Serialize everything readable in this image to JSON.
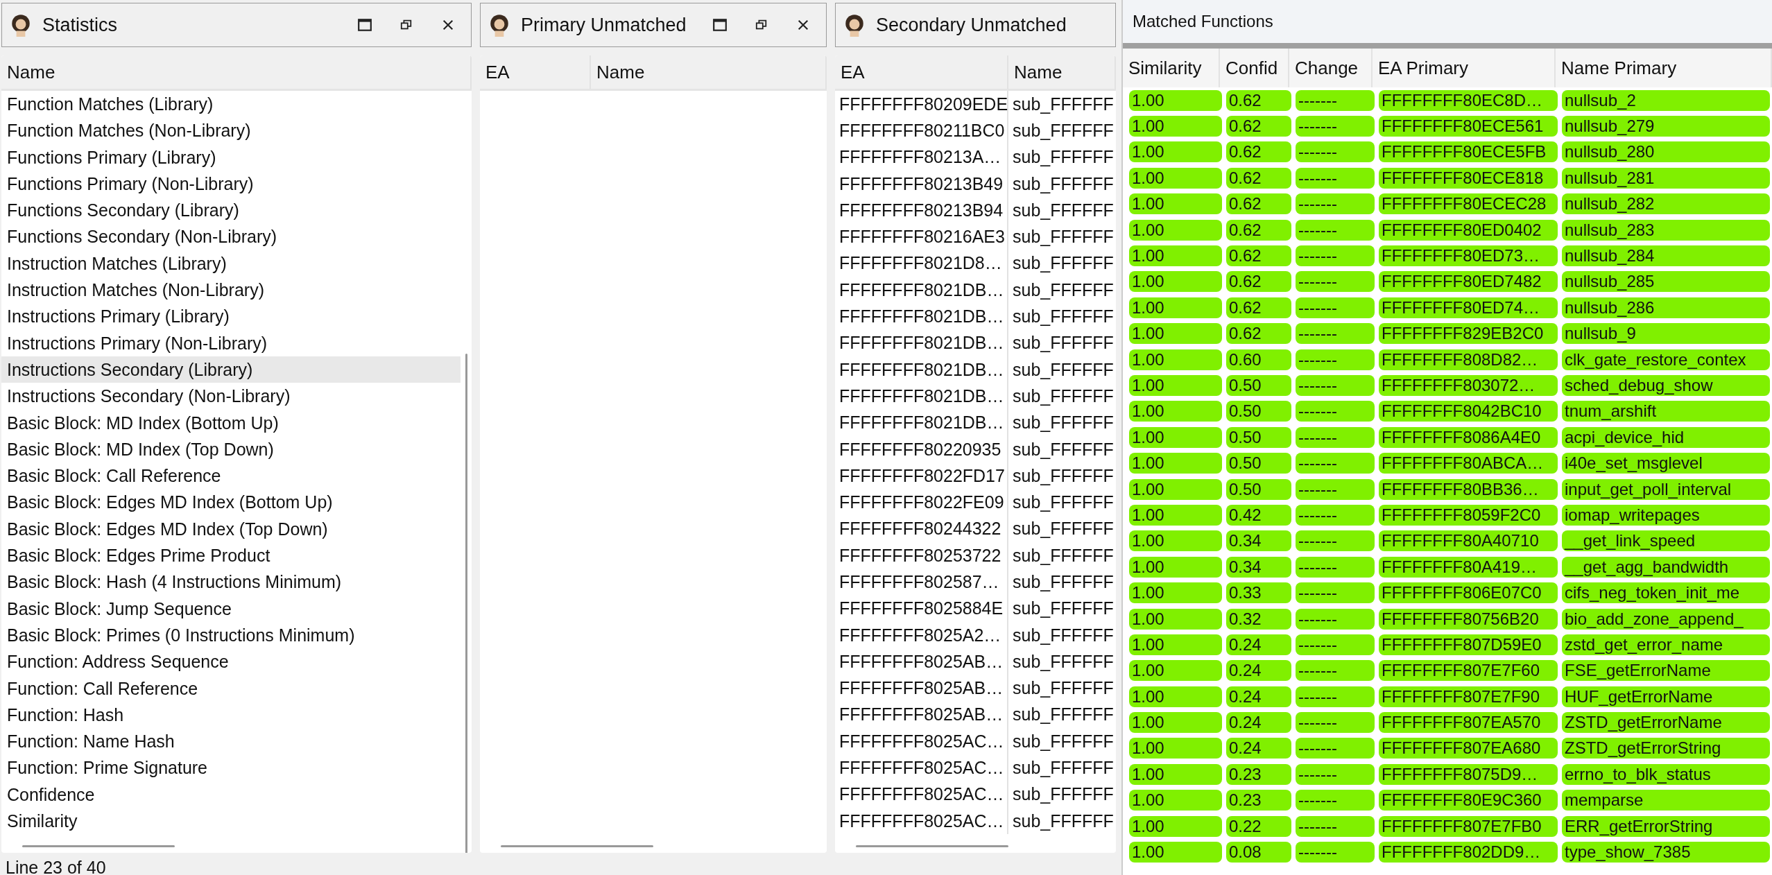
{
  "statistics": {
    "title": "Statistics",
    "column": "Name",
    "items": [
      {
        "label": "Function Matches (Library)",
        "selected": false
      },
      {
        "label": "Function Matches (Non-Library)",
        "selected": false
      },
      {
        "label": "Functions Primary (Library)",
        "selected": false
      },
      {
        "label": "Functions Primary (Non-Library)",
        "selected": false
      },
      {
        "label": "Functions Secondary (Library)",
        "selected": false
      },
      {
        "label": "Functions Secondary (Non-Library)",
        "selected": false
      },
      {
        "label": "Instruction Matches (Library)",
        "selected": false
      },
      {
        "label": "Instruction Matches (Non-Library)",
        "selected": false
      },
      {
        "label": "Instructions Primary (Library)",
        "selected": false
      },
      {
        "label": "Instructions Primary (Non-Library)",
        "selected": false
      },
      {
        "label": "Instructions Secondary (Library)",
        "selected": true
      },
      {
        "label": "Instructions Secondary (Non-Library)",
        "selected": false
      },
      {
        "label": "Basic Block: MD Index (Bottom Up)",
        "selected": false
      },
      {
        "label": "Basic Block: MD Index (Top Down)",
        "selected": false
      },
      {
        "label": "Basic Block: Call Reference",
        "selected": false
      },
      {
        "label": "Basic Block: Edges MD Index (Bottom Up)",
        "selected": false
      },
      {
        "label": "Basic Block: Edges MD Index (Top Down)",
        "selected": false
      },
      {
        "label": "Basic Block: Edges Prime Product",
        "selected": false
      },
      {
        "label": "Basic Block: Hash (4 Instructions Minimum)",
        "selected": false
      },
      {
        "label": "Basic Block: Jump Sequence",
        "selected": false
      },
      {
        "label": "Basic Block: Primes (0 Instructions Minimum)",
        "selected": false
      },
      {
        "label": "Function: Address Sequence",
        "selected": false
      },
      {
        "label": "Function: Call Reference",
        "selected": false
      },
      {
        "label": "Function: Hash",
        "selected": false
      },
      {
        "label": "Function: Name Hash",
        "selected": false
      },
      {
        "label": "Function: Prime Signature",
        "selected": false
      },
      {
        "label": "Confidence",
        "selected": false
      },
      {
        "label": "Similarity",
        "selected": false
      }
    ]
  },
  "primary_unmatched": {
    "title": "Primary Unmatched",
    "columns": [
      "EA",
      "Name"
    ]
  },
  "secondary_unmatched": {
    "title": "Secondary Unmatched",
    "columns": [
      "EA",
      "Name"
    ],
    "rows": [
      [
        "FFFFFFFF80209EDE",
        "sub_FFFFFF"
      ],
      [
        "FFFFFFFF80211BC0",
        "sub_FFFFFF"
      ],
      [
        "FFFFFFFF80213A…",
        "sub_FFFFFF"
      ],
      [
        "FFFFFFFF80213B49",
        "sub_FFFFFF"
      ],
      [
        "FFFFFFFF80213B94",
        "sub_FFFFFF"
      ],
      [
        "FFFFFFFF80216AE3",
        "sub_FFFFFF"
      ],
      [
        "FFFFFFFF8021D8…",
        "sub_FFFFFF"
      ],
      [
        "FFFFFFFF8021DB…",
        "sub_FFFFFF"
      ],
      [
        "FFFFFFFF8021DB…",
        "sub_FFFFFF"
      ],
      [
        "FFFFFFFF8021DB…",
        "sub_FFFFFF"
      ],
      [
        "FFFFFFFF8021DB…",
        "sub_FFFFFF"
      ],
      [
        "FFFFFFFF8021DB…",
        "sub_FFFFFF"
      ],
      [
        "FFFFFFFF8021DB…",
        "sub_FFFFFF"
      ],
      [
        "FFFFFFFF80220935",
        "sub_FFFFFF"
      ],
      [
        "FFFFFFFF8022FD17",
        "sub_FFFFFF"
      ],
      [
        "FFFFFFFF8022FE09",
        "sub_FFFFFF"
      ],
      [
        "FFFFFFFF80244322",
        "sub_FFFFFF"
      ],
      [
        "FFFFFFFF80253722",
        "sub_FFFFFF"
      ],
      [
        "FFFFFFFF802587…",
        "sub_FFFFFF"
      ],
      [
        "FFFFFFFF8025884E",
        "sub_FFFFFF"
      ],
      [
        "FFFFFFFF8025A2…",
        "sub_FFFFFF"
      ],
      [
        "FFFFFFFF8025AB…",
        "sub_FFFFFF"
      ],
      [
        "FFFFFFFF8025AB…",
        "sub_FFFFFF"
      ],
      [
        "FFFFFFFF8025AB…",
        "sub_FFFFFF"
      ],
      [
        "FFFFFFFF8025AC…",
        "sub_FFFFFF"
      ],
      [
        "FFFFFFFF8025AC…",
        "sub_FFFFFF"
      ],
      [
        "FFFFFFFF8025AC…",
        "sub_FFFFFF"
      ],
      [
        "FFFFFFFF8025AC…",
        "sub_FFFFFF"
      ]
    ]
  },
  "matched_functions": {
    "title": "Matched Functions",
    "columns": [
      "Similarity",
      "Confid",
      "Change",
      "EA Primary",
      "Name Primary"
    ],
    "rows": [
      [
        "1.00",
        "0.62",
        "-------",
        "FFFFFFFF80EC8D…",
        "nullsub_2"
      ],
      [
        "1.00",
        "0.62",
        "-------",
        "FFFFFFFF80ECE561",
        "nullsub_279"
      ],
      [
        "1.00",
        "0.62",
        "-------",
        "FFFFFFFF80ECE5FB",
        "nullsub_280"
      ],
      [
        "1.00",
        "0.62",
        "-------",
        "FFFFFFFF80ECE818",
        "nullsub_281"
      ],
      [
        "1.00",
        "0.62",
        "-------",
        "FFFFFFFF80ECEC28",
        "nullsub_282"
      ],
      [
        "1.00",
        "0.62",
        "-------",
        "FFFFFFFF80ED0402",
        "nullsub_283"
      ],
      [
        "1.00",
        "0.62",
        "-------",
        "FFFFFFFF80ED73…",
        "nullsub_284"
      ],
      [
        "1.00",
        "0.62",
        "-------",
        "FFFFFFFF80ED7482",
        "nullsub_285"
      ],
      [
        "1.00",
        "0.62",
        "-------",
        "FFFFFFFF80ED74…",
        "nullsub_286"
      ],
      [
        "1.00",
        "0.62",
        "-------",
        "FFFFFFFF829EB2C0",
        "nullsub_9"
      ],
      [
        "1.00",
        "0.60",
        "-------",
        "FFFFFFFF808D82…",
        "clk_gate_restore_contex"
      ],
      [
        "1.00",
        "0.50",
        "-------",
        "FFFFFFFF803072…",
        "sched_debug_show"
      ],
      [
        "1.00",
        "0.50",
        "-------",
        "FFFFFFFF8042BC10",
        "tnum_arshift"
      ],
      [
        "1.00",
        "0.50",
        "-------",
        "FFFFFFFF8086A4E0",
        "acpi_device_hid"
      ],
      [
        "1.00",
        "0.50",
        "-------",
        "FFFFFFFF80ABCA…",
        "i40e_set_msglevel"
      ],
      [
        "1.00",
        "0.50",
        "-------",
        "FFFFFFFF80BB36…",
        "input_get_poll_interval"
      ],
      [
        "1.00",
        "0.42",
        "-------",
        "FFFFFFFF8059F2C0",
        "iomap_writepages"
      ],
      [
        "1.00",
        "0.34",
        "-------",
        "FFFFFFFF80A40710",
        "__get_link_speed"
      ],
      [
        "1.00",
        "0.34",
        "-------",
        "FFFFFFFF80A419…",
        "__get_agg_bandwidth"
      ],
      [
        "1.00",
        "0.33",
        "-------",
        "FFFFFFFF806E07C0",
        "cifs_neg_token_init_me"
      ],
      [
        "1.00",
        "0.32",
        "-------",
        "FFFFFFFF80756B20",
        "bio_add_zone_append_"
      ],
      [
        "1.00",
        "0.24",
        "-------",
        "FFFFFFFF807D59E0",
        "zstd_get_error_name"
      ],
      [
        "1.00",
        "0.24",
        "-------",
        "FFFFFFFF807E7F60",
        "FSE_getErrorName"
      ],
      [
        "1.00",
        "0.24",
        "-------",
        "FFFFFFFF807E7F90",
        "HUF_getErrorName"
      ],
      [
        "1.00",
        "0.24",
        "-------",
        "FFFFFFFF807EA570",
        "ZSTD_getErrorName"
      ],
      [
        "1.00",
        "0.24",
        "-------",
        "FFFFFFFF807EA680",
        "ZSTD_getErrorString"
      ],
      [
        "1.00",
        "0.23",
        "-------",
        "FFFFFFFF8075D9…",
        "errno_to_blk_status"
      ],
      [
        "1.00",
        "0.23",
        "-------",
        "FFFFFFFF80E9C360",
        "memparse"
      ],
      [
        "1.00",
        "0.22",
        "-------",
        "FFFFFFFF807E7FB0",
        "ERR_getErrorString"
      ],
      [
        "1.00",
        "0.08",
        "-------",
        "FFFFFFFF802DD9…",
        "type_show_7385"
      ]
    ]
  },
  "status_bar": "Line 23 of 40"
}
